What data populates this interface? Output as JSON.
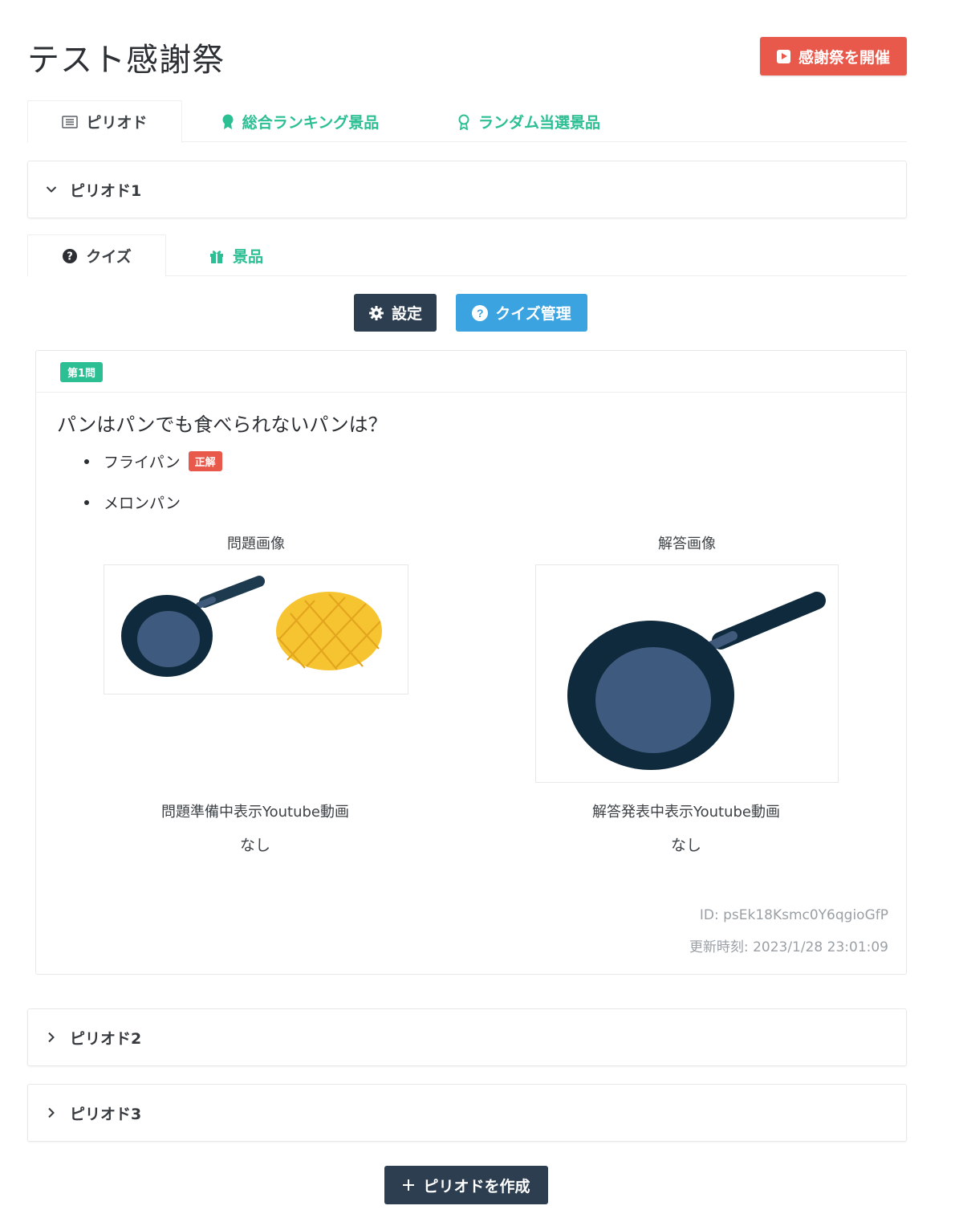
{
  "header": {
    "title": "テスト感謝祭",
    "hold_button_label": "感謝祭を開催"
  },
  "main_tabs": [
    {
      "label": "ピリオド",
      "icon": "list-icon",
      "active": true
    },
    {
      "label": "総合ランキング景品",
      "icon": "badge-filled-icon",
      "active": false
    },
    {
      "label": "ランダム当選景品",
      "icon": "badge-outline-icon",
      "active": false
    }
  ],
  "periods": [
    {
      "label": "ピリオド1",
      "expanded": true
    },
    {
      "label": "ピリオド2",
      "expanded": false
    },
    {
      "label": "ピリオド3",
      "expanded": false
    }
  ],
  "period_tabs": [
    {
      "label": "クイズ",
      "icon": "question-circle-icon",
      "active": true
    },
    {
      "label": "景品",
      "icon": "gift-icon",
      "active": false
    }
  ],
  "actions": {
    "settings_label": "設定",
    "quiz_manage_label": "クイズ管理"
  },
  "quiz": {
    "badge": "第1問",
    "question": "パンはパンでも食べられないパンは？",
    "choices": [
      {
        "text": "フライパン",
        "correct": true
      },
      {
        "text": "メロンパン",
        "correct": false
      }
    ],
    "correct_label": "正解",
    "question_image_label": "問題画像",
    "answer_image_label": "解答画像",
    "question_video_label": "問題準備中表示Youtube動画",
    "question_video_value": "なし",
    "answer_video_label": "解答発表中表示Youtube動画",
    "answer_video_value": "なし",
    "id_text": "ID: psEk18Ksmc0Y6qgioGfP",
    "updated_text": "更新時刻: 2023/1/28 23:01:09"
  },
  "create_period_label": "ピリオドを作成",
  "colors": {
    "accent_green": "#2dbf94",
    "danger_red": "#e8584b",
    "dark_navy": "#2c3e50",
    "info_blue": "#3ba4e0"
  }
}
